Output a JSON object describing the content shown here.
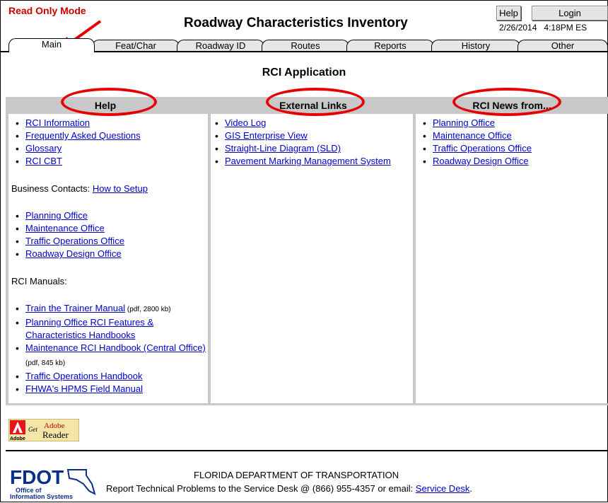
{
  "header": {
    "read_only": "Read Only Mode",
    "title": "Roadway Characteristics Inventory",
    "help_label": "Help",
    "login_label": "Login",
    "date": "2/26/2014",
    "time": "4:18PM ES"
  },
  "tabs": [
    {
      "label": "Main"
    },
    {
      "label": "Feat/Char"
    },
    {
      "label": "Roadway ID"
    },
    {
      "label": "Routes"
    },
    {
      "label": "Reports"
    },
    {
      "label": "History"
    },
    {
      "label": "Other"
    }
  ],
  "section_title": "RCI Application",
  "columns": {
    "help": {
      "header": "Help",
      "links": [
        "RCI Information",
        "Frequently Asked Questions",
        "Glossary",
        "RCI CBT"
      ],
      "business_label": "Business Contacts: ",
      "business_link": "How to Setup",
      "contacts": [
        "Planning Office",
        "Maintenance Office",
        "Traffic Operations Office",
        "Roadway Design Office"
      ],
      "manuals_label": "RCI Manuals:",
      "manuals": [
        {
          "text": "Train the Trainer Manual",
          "note": " (pdf, 2800 kb)"
        },
        {
          "text": "Planning Office RCI Features & Characteristics Handbooks",
          "note": ""
        },
        {
          "text": "Maintenance RCI Handbook (Central Office)",
          "note": " (pdf, 845 kb)"
        },
        {
          "text": "Traffic Operations Handbook",
          "note": ""
        },
        {
          "text": "FHWA's HPMS Field Manual",
          "note": ""
        }
      ]
    },
    "external": {
      "header": "External Links",
      "links": [
        "Video Log",
        "GIS Enterprise View",
        "Straight-Line Diagram (SLD)",
        "Pavement Marking Management System"
      ]
    },
    "news": {
      "header": "RCI News from...",
      "links": [
        "Planning Office",
        "Maintenance Office",
        "Traffic Operations Office",
        "Roadway Design Office"
      ]
    }
  },
  "adobe": {
    "brand": "Adobe",
    "get": "Get",
    "name": "Adobe",
    "product": "Reader"
  },
  "footer": {
    "logo_text": "FDOT",
    "logo_sub1": "Office of",
    "logo_sub2": "Information Systems",
    "title": "FLORIDA DEPARTMENT OF TRANSPORTATION",
    "line_prefix": "Report Technical Problems to the Service Desk @ (866) 955-4357 or email: ",
    "link": "Service Desk",
    "line_suffix": "."
  },
  "colors": {
    "annotation": "#e60000",
    "link": "#0000cc",
    "header_gray": "#c8c8c8",
    "read_only": "#cc0000"
  }
}
